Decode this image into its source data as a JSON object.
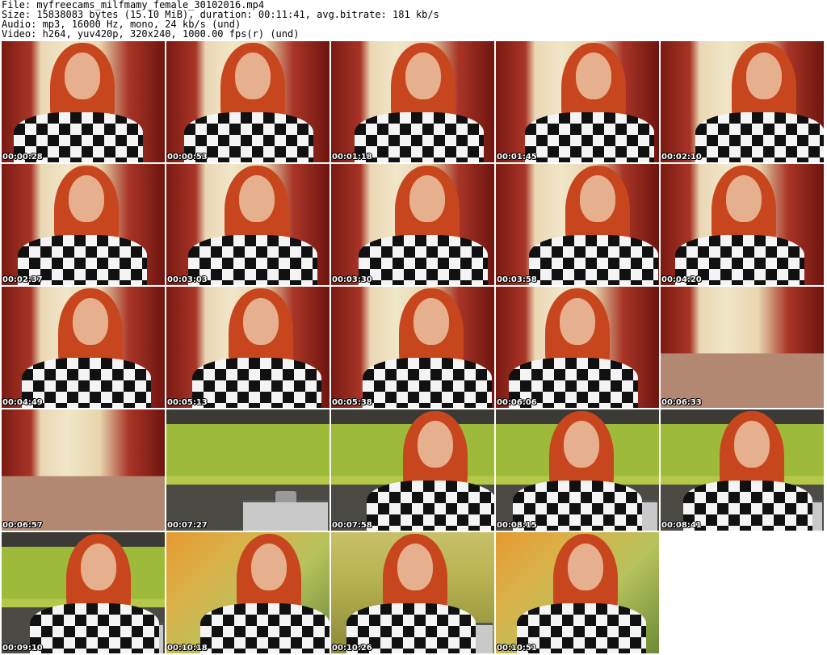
{
  "header": {
    "file_line": "File: myfreecams_milfmamy_female_30102016.mp4",
    "size_line": "Size: 15838083 bytes (15.10 MiB), duration: 00:11:41, avg.bitrate: 181 kb/s",
    "audio_line": "Audio: mp3, 16000 Hz, mono, 24 kb/s (und)",
    "video_line": "Video: h264, yuv420p, 320x240, 1000.00 fps(r) (und)"
  },
  "thumbnails": [
    {
      "time": "00:00:28",
      "scene": "bedroom",
      "person": true
    },
    {
      "time": "00:00:53",
      "scene": "bedroom",
      "person": true
    },
    {
      "time": "00:01:18",
      "scene": "bedroom",
      "person": true
    },
    {
      "time": "00:01:45",
      "scene": "bedroom",
      "person": true
    },
    {
      "time": "00:02:10",
      "scene": "bedroom",
      "person": true
    },
    {
      "time": "00:02:37",
      "scene": "bedroom",
      "person": true
    },
    {
      "time": "00:03:03",
      "scene": "bedroom",
      "person": true
    },
    {
      "time": "00:03:30",
      "scene": "bedroom",
      "person": true
    },
    {
      "time": "00:03:58",
      "scene": "bedroom",
      "person": true
    },
    {
      "time": "00:04:20",
      "scene": "bedroom",
      "person": true
    },
    {
      "time": "00:04:49",
      "scene": "bedroom",
      "person": true
    },
    {
      "time": "00:05:13",
      "scene": "bedroom",
      "person": true
    },
    {
      "time": "00:05:38",
      "scene": "bedroom",
      "person": true
    },
    {
      "time": "00:06:06",
      "scene": "bedroom",
      "person": true
    },
    {
      "time": "00:06:33",
      "scene": "bedroom-empty",
      "person": false
    },
    {
      "time": "00:06:57",
      "scene": "bedroom-empty",
      "person": false
    },
    {
      "time": "00:07:27",
      "scene": "kitchen",
      "person": false
    },
    {
      "time": "00:07:58",
      "scene": "kitchen",
      "person": true
    },
    {
      "time": "00:08:15",
      "scene": "kitchen",
      "person": true
    },
    {
      "time": "00:08:41",
      "scene": "kitchen",
      "person": true
    },
    {
      "time": "00:09:10",
      "scene": "kitchen",
      "person": true
    },
    {
      "time": "00:10:18",
      "scene": "yellow",
      "person": true
    },
    {
      "time": "00:10:26",
      "scene": "kitchen-close",
      "person": true
    },
    {
      "time": "00:10:51",
      "scene": "yellow",
      "person": true
    }
  ]
}
